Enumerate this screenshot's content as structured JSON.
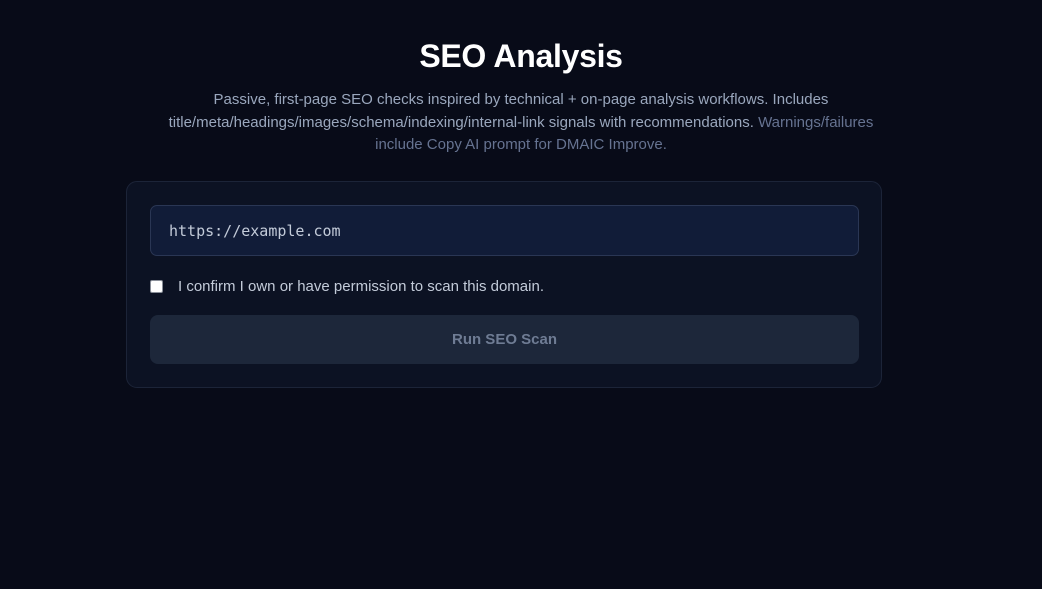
{
  "header": {
    "title": "SEO Analysis",
    "description_main": "Passive, first-page SEO checks inspired by technical + on-page analysis workflows. Includes title/meta/headings/images/schema/indexing/internal-link signals with recommendations.",
    "description_muted": "Warnings/failures include Copy AI prompt for DMAIC Improve."
  },
  "form": {
    "url_placeholder": "https://example.com",
    "url_value": "",
    "confirm_checked": false,
    "confirm_label": "I confirm I own or have permission to scan this domain.",
    "run_button_label": "Run SEO Scan"
  },
  "colors": {
    "background": "#080b18",
    "card": "#0c1223",
    "input": "#111c38",
    "button_disabled": "#1d273a"
  }
}
